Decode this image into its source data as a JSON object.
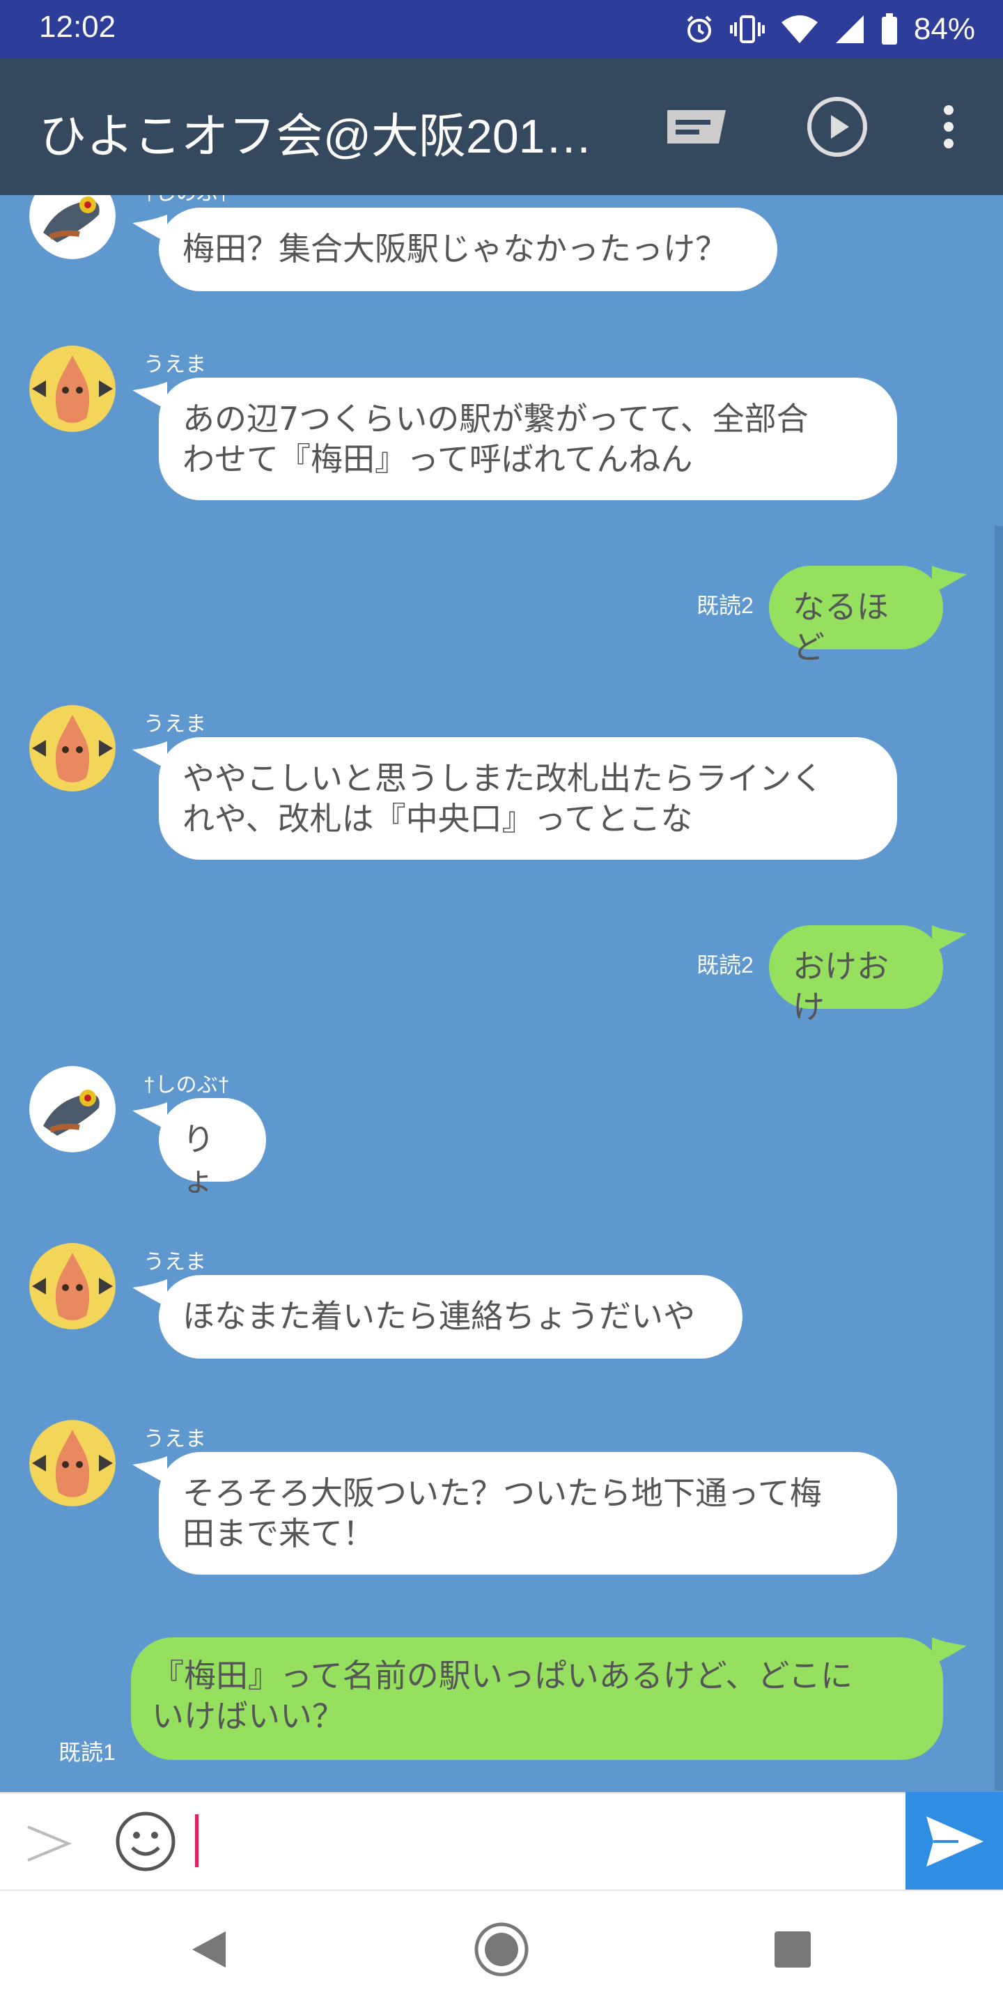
{
  "status_bar": {
    "time": "12:02",
    "battery": "84%",
    "icons": [
      "alarm-icon",
      "vibrate-icon",
      "wifi-icon",
      "signal-icon",
      "battery-icon"
    ]
  },
  "app_bar": {
    "title": "ひよこオフ会@大阪201…",
    "icons": [
      "message-icon",
      "play-icon",
      "more-icon"
    ]
  },
  "messages": [
    {
      "type": "in",
      "sender": "†しのぶ†",
      "lines": [
        "梅田？集合大阪駅じゃなかったっけ？"
      ]
    },
    {
      "type": "in",
      "sender": "うえま",
      "lines": [
        "あの辺7つくらいの駅が繋がってて、全部合",
        "わせて『梅田』って呼ばれてんねん"
      ]
    },
    {
      "type": "out",
      "read": "既読2",
      "lines": [
        "なるほど"
      ]
    },
    {
      "type": "in",
      "sender": "うえま",
      "lines": [
        "ややこしいと思うしまた改札出たらラインく",
        "れや、改札は『中央口』ってとこな"
      ]
    },
    {
      "type": "out",
      "read": "既読2",
      "lines": [
        "おけおけ"
      ]
    },
    {
      "type": "in",
      "sender": "†しのぶ†",
      "lines": [
        "りょ"
      ]
    },
    {
      "type": "in",
      "sender": "うえま",
      "lines": [
        "ほなまた着いたら連絡ちょうだいや"
      ]
    },
    {
      "type": "in",
      "sender": "うえま",
      "lines": [
        "そろそろ大阪ついた？ついたら地下通って梅",
        "田まで来て！"
      ]
    },
    {
      "type": "out",
      "read": "既読1",
      "lines": [
        "『梅田』って名前の駅いっぱいあるけど、どこに",
        "いけばいい？"
      ]
    }
  ],
  "input": {
    "value": "",
    "icons": [
      "expand-icon",
      "emoji-icon",
      "send-icon"
    ]
  },
  "nav_bar": {
    "icons": [
      "back-icon",
      "home-icon",
      "recents-icon"
    ]
  },
  "colors": {
    "status_bar": "#2f3d9a",
    "app_bar": "#34495e",
    "chat_background": "#5e98cf",
    "outgoing_bubble": "#95e05f",
    "incoming_bubble": "#ffffff",
    "send_button": "#2f8de4",
    "cursor": "#e0205a"
  }
}
